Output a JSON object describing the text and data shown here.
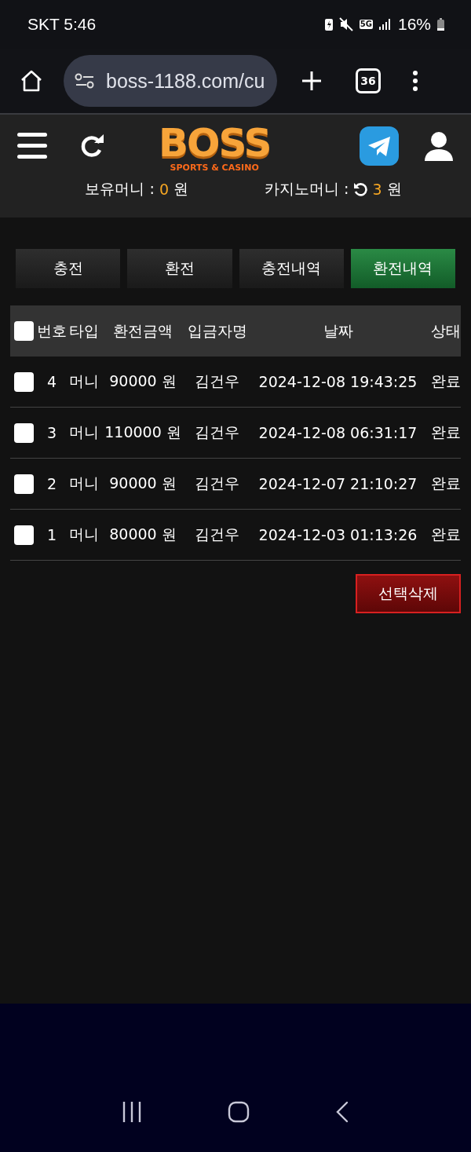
{
  "status_bar": {
    "carrier_time": "SKT 5:46",
    "network": "5G",
    "battery": "16%"
  },
  "browser": {
    "url": "boss-1188.com/cu",
    "tab_count": "36"
  },
  "header": {
    "logo": {
      "title": "BOSS",
      "subtitle": "SPORTS & CASINO"
    },
    "balances": [
      {
        "label": "보유머니 :",
        "value": "0",
        "unit": "원",
        "refresh": false
      },
      {
        "label": "카지노머니 :",
        "value": "3",
        "unit": "원",
        "refresh": true
      }
    ]
  },
  "tabs": [
    {
      "label": "충전",
      "selected": false
    },
    {
      "label": "환전",
      "selected": false
    },
    {
      "label": "충전내역",
      "selected": false
    },
    {
      "label": "환전내역",
      "selected": true
    }
  ],
  "table": {
    "select_all": {
      "checked": false
    },
    "columns": [
      "번호",
      "타입",
      "환전금액",
      "입금자명",
      "날짜",
      "상태"
    ],
    "rows": [
      {
        "checked": false,
        "cells": [
          "4",
          "머니",
          "90000 원",
          "김건우",
          "2024-12-08 19:43:25",
          "완료"
        ]
      },
      {
        "checked": false,
        "cells": [
          "3",
          "머니",
          "110000 원",
          "김건우",
          "2024-12-08 06:31:17",
          "완료"
        ]
      },
      {
        "checked": false,
        "cells": [
          "2",
          "머니",
          "90000 원",
          "김건우",
          "2024-12-07 21:10:27",
          "완료"
        ]
      },
      {
        "checked": false,
        "cells": [
          "1",
          "머니",
          "80000 원",
          "김건우",
          "2024-12-03 01:13:26",
          "완료"
        ]
      }
    ]
  },
  "delete_button": "선택삭제"
}
